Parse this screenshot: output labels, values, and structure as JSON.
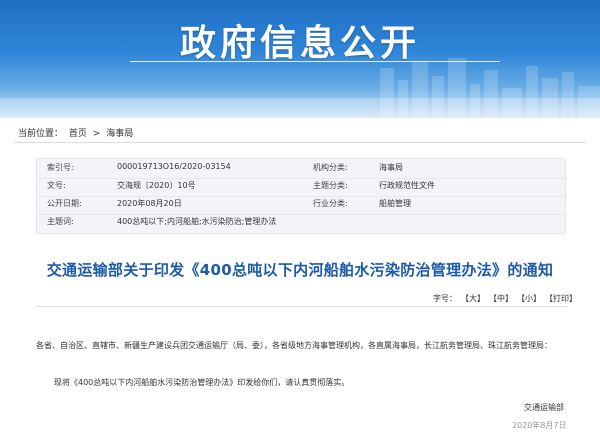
{
  "banner": {
    "title": "政府信息公开"
  },
  "breadcrumb": {
    "prefix": "当前位置：",
    "home": "首页",
    "separator": ">",
    "current": "海事局"
  },
  "info": {
    "rows": [
      {
        "l1": "索引号:",
        "v1": "000019713O16/2020-03154",
        "l2": "机构分类:",
        "v2": "海事局"
      },
      {
        "l1": "文号:",
        "v1": "交海规〔2020〕10号",
        "l2": "主题分类:",
        "v2": "行政规范性文件"
      },
      {
        "l1": "公开日期:",
        "v1": "2020年08月20日",
        "l2": "行业分类:",
        "v2": "船舶管理"
      },
      {
        "l1": "主题词:",
        "v1": "400总吨以下;内河船舶;水污染防治;管理办法",
        "l2": "",
        "v2": ""
      }
    ]
  },
  "doc": {
    "title": "交通运输部关于印发《400总吨以下内河船舶水污染防治管理办法》的通知"
  },
  "toolbar": {
    "label": "字号：",
    "large": "【大】",
    "medium": "【中】",
    "small": "【小】",
    "print": "【打印】"
  },
  "body": {
    "para1": "各省、自治区、直辖市、新疆生产建设兵团交通运输厅（局、委），各省级地方海事管理机构，各直属海事局，长江航务管理局、珠江航务管理局：",
    "para2": "现将《400总吨以下内河船舶水污染防治管理办法》印发给你们，请认真贯彻落实。",
    "signature": "交通运输部",
    "date": "2020年8月7日"
  },
  "colors": {
    "banner": "#2f86d8",
    "title": "#1d5aa8",
    "info_bg": "#f2f4f7"
  }
}
